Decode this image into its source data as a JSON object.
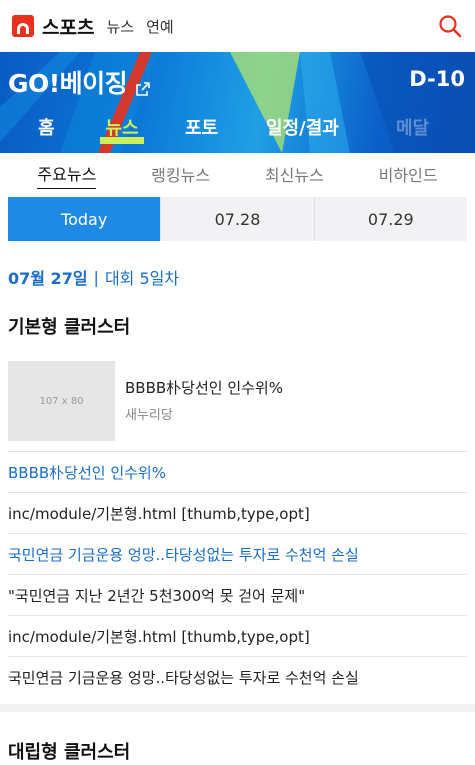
{
  "header": {
    "brand": "스포츠",
    "links": [
      "뉴스",
      "연예"
    ]
  },
  "banner": {
    "title": "GO!베이징",
    "dday": "D-10",
    "nav": [
      {
        "label": "홈",
        "state": "normal"
      },
      {
        "label": "뉴스",
        "state": "active"
      },
      {
        "label": "포토",
        "state": "normal"
      },
      {
        "label": "일정/결과",
        "state": "normal"
      },
      {
        "label": "메달",
        "state": "disabled"
      }
    ]
  },
  "subtabs": [
    "주요뉴스",
    "랭킹뉴스",
    "최신뉴스",
    "비하인드"
  ],
  "datetabs": [
    "Today",
    "07.28",
    "07.29"
  ],
  "day": {
    "date": "07월 27일",
    "separator": "|",
    "label": "대회 5일차"
  },
  "section1": {
    "title": "기본형 클러스터",
    "thumb": {
      "placeholder": "107 x 80",
      "title": "BBBB朴당선인 인수위%",
      "source": "새누리당"
    },
    "items": [
      {
        "text": "BBBB朴당선인 인수위%",
        "style": "blue"
      },
      {
        "text": "inc/module/기본형.html [thumb,type,opt]",
        "style": "normal"
      },
      {
        "text": "국민연금 기금운용 엉망..타당성없는 투자로 수천억 손실",
        "style": "blue"
      },
      {
        "text": "\"국민연금 지난 2년간 5천300억 못 걷어 문제\"",
        "style": "normal"
      },
      {
        "text": "inc/module/기본형.html [thumb,type,opt]",
        "style": "normal"
      },
      {
        "text": "국민연금 기금운용 엉망..타당성없는 투자로 수천억 손실",
        "style": "normal"
      }
    ]
  },
  "section2": {
    "title": "대립형 클러스터"
  },
  "colors": {
    "accent": "#1f8ae6",
    "brand_red": "#e8311a",
    "nav_active": "#c9ef5a",
    "link_blue": "#1a6ec8"
  }
}
